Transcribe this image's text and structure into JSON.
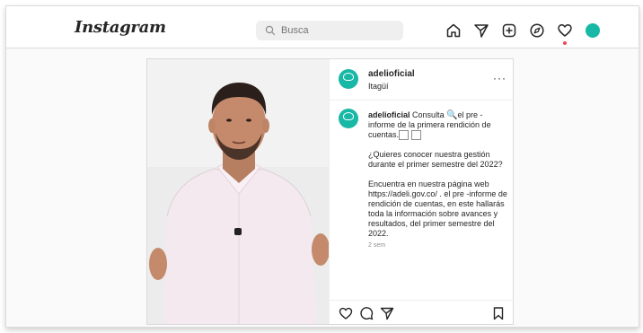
{
  "header": {
    "logo_text": "Instagram",
    "logo_chevron": "⌄",
    "search_placeholder": "Busca",
    "nav_icons": [
      "home-icon",
      "direct-icon",
      "new-post-icon",
      "explore-icon",
      "activity-icon",
      "profile-avatar"
    ]
  },
  "post": {
    "username": "adelioficial",
    "location": "Itagüí",
    "more": "···",
    "caption": {
      "user": "adelioficial",
      "line1_text": "Consulta",
      "line1_icon": "magnifier-icon",
      "line1_rest": "el pre - informe de la primera rendición de cuentas.",
      "glyphs": [
        "□",
        "□"
      ],
      "paragraph2": "¿Quieres conocer nuestra gestión durante el primer semestre del 2022?",
      "paragraph3": "Encuentra en nuestra página web https://adeli.gov.co/ . el pre -informe de rendición de cuentas, en este hallarás toda la información sobre avances y resultados, del primer semestre del 2022."
    },
    "time_ago": "2 sem",
    "actions": [
      "like-icon",
      "comment-icon",
      "share-icon",
      "save-icon"
    ]
  },
  "colors": {
    "brand_teal": "#17b8a6",
    "notification_red": "#ed4956",
    "text_primary": "#262626",
    "text_secondary": "#8e8e8e"
  }
}
